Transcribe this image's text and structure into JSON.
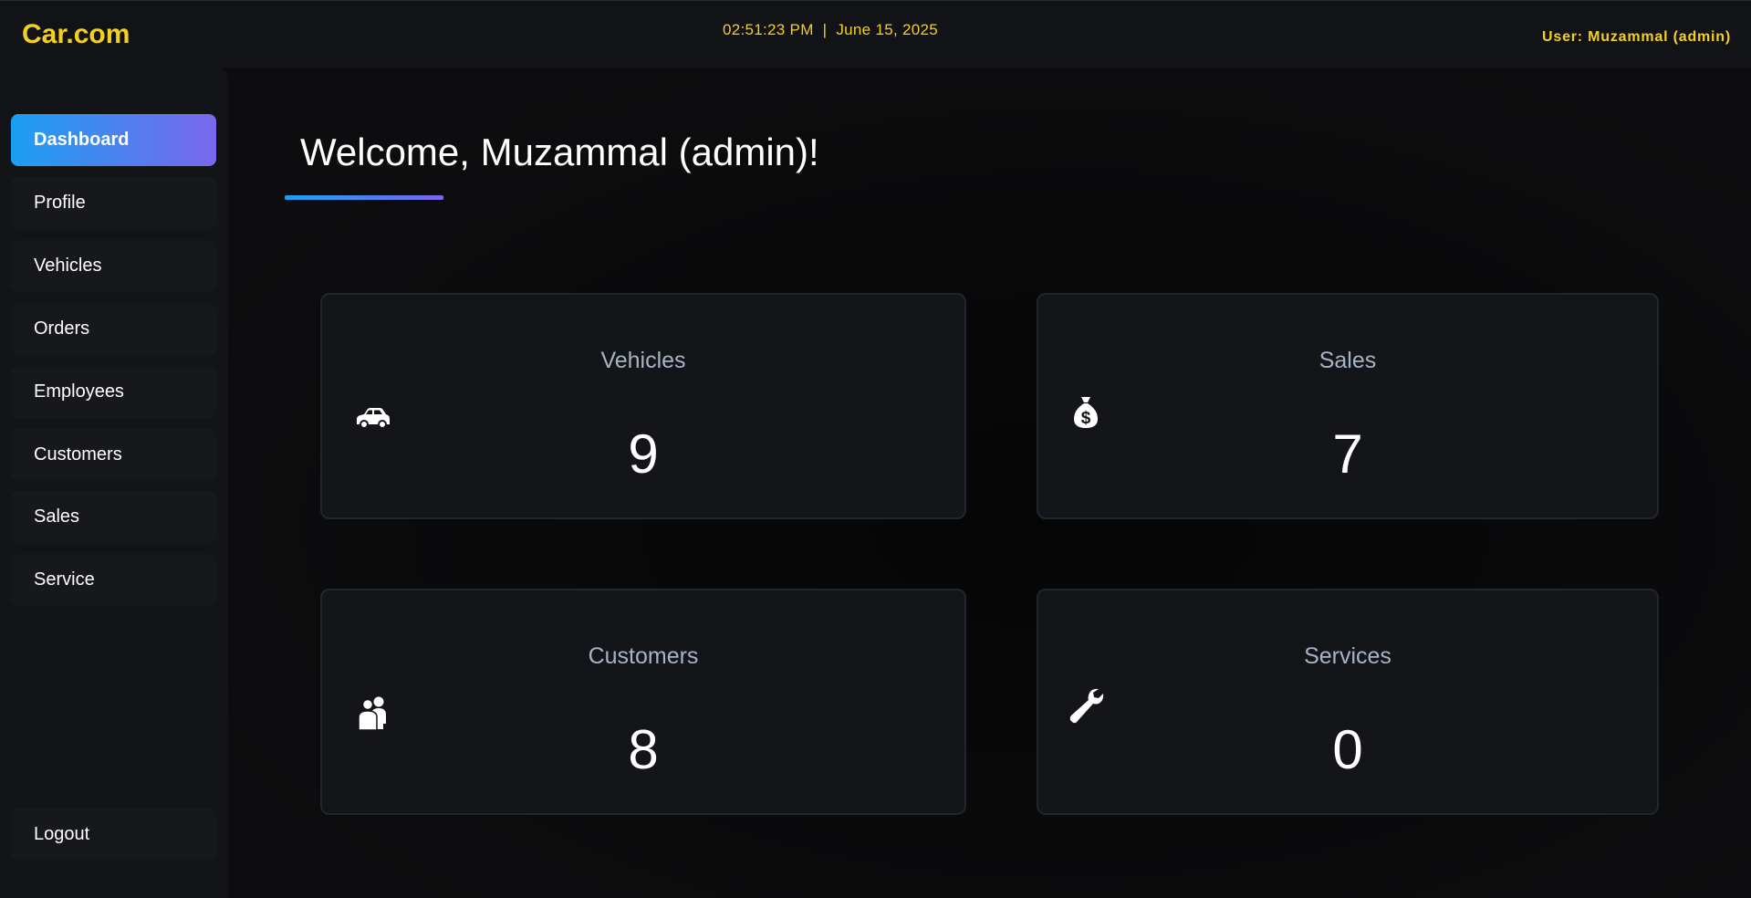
{
  "header": {
    "brand": "Car.com",
    "time": "02:51:23 PM",
    "separator": "|",
    "date": "June 15, 2025",
    "user_label": "User: Muzammal (admin)"
  },
  "sidebar": {
    "items": [
      {
        "label": "Dashboard",
        "active": true
      },
      {
        "label": "Profile"
      },
      {
        "label": "Vehicles"
      },
      {
        "label": "Orders"
      },
      {
        "label": "Employees"
      },
      {
        "label": "Customers"
      },
      {
        "label": "Sales"
      },
      {
        "label": "Service"
      }
    ],
    "logout_label": "Logout"
  },
  "main": {
    "welcome": "Welcome, Muzammal (admin)!",
    "cards": [
      {
        "title": "Vehicles",
        "value": "9",
        "icon": "car-icon"
      },
      {
        "title": "Sales",
        "value": "7",
        "icon": "money-bag-icon"
      },
      {
        "title": "Customers",
        "value": "8",
        "icon": "users-icon"
      },
      {
        "title": "Services",
        "value": "0",
        "icon": "wrench-icon"
      }
    ]
  },
  "colors": {
    "accent_yellow": "#f5cf1e",
    "gradient_start": "#1a9ff2",
    "gradient_end": "#7a67ee",
    "card_title": "#a7b4c6"
  }
}
